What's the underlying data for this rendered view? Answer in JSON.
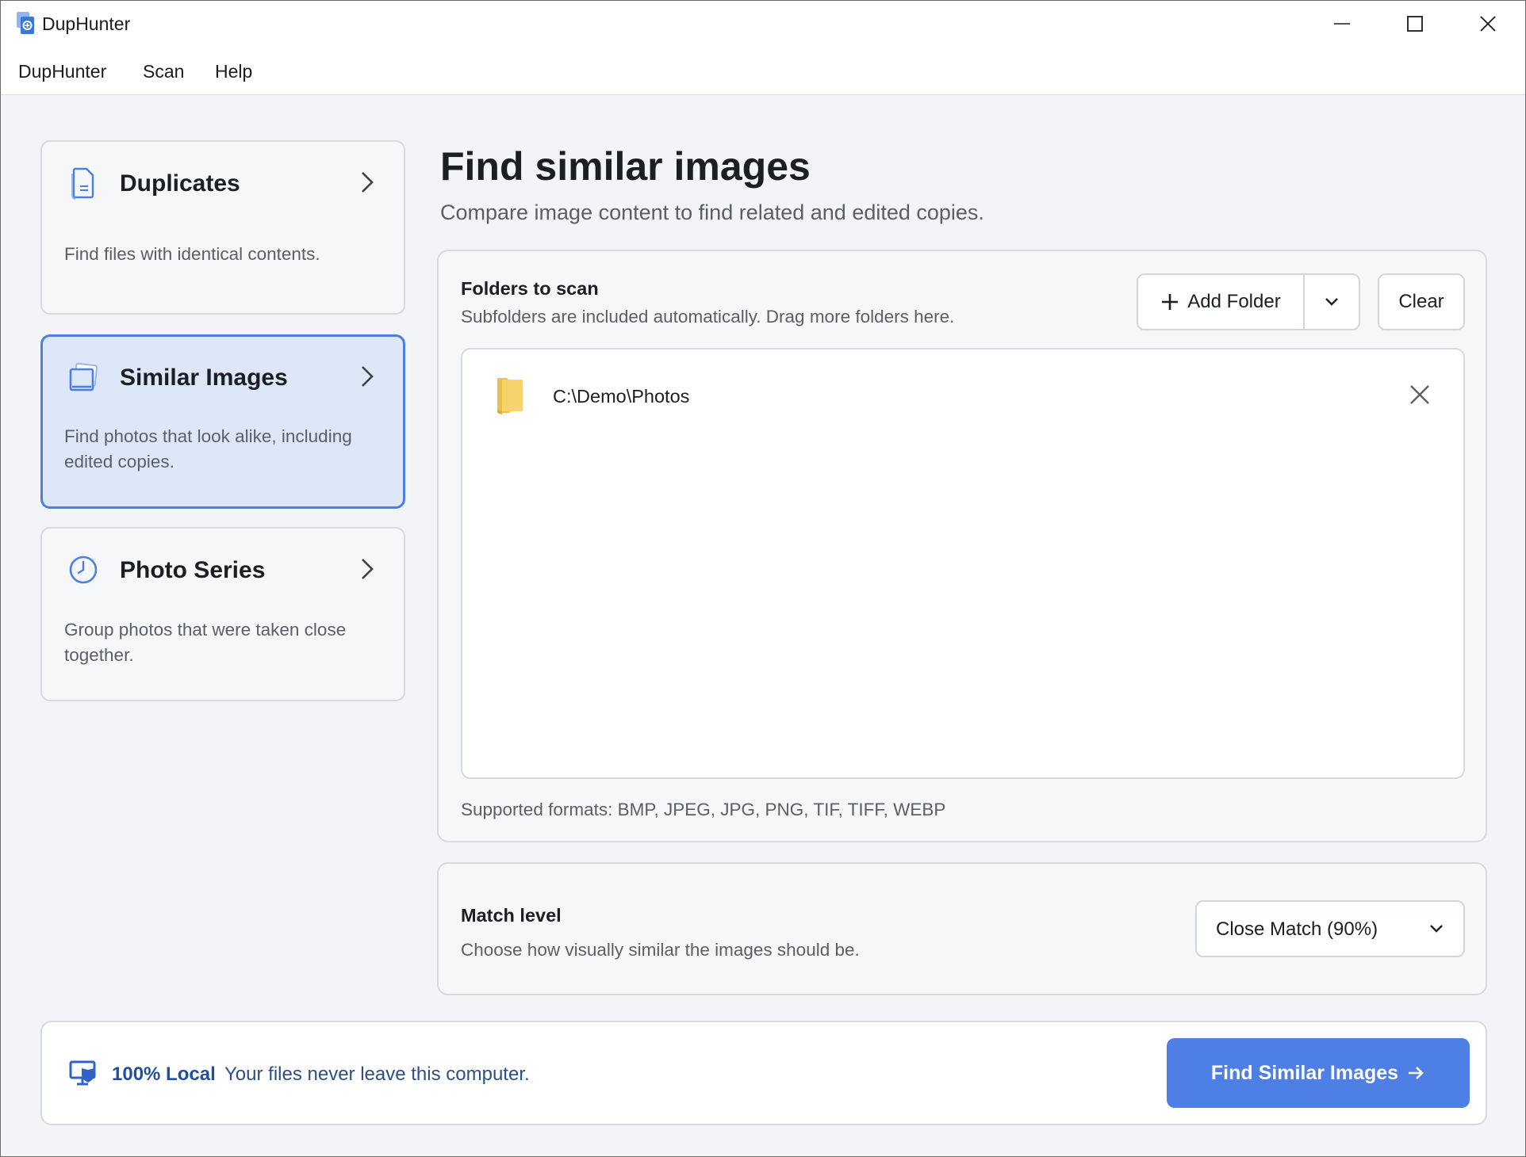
{
  "window": {
    "title": "DupHunter"
  },
  "menubar": {
    "items": [
      "DupHunter",
      "Scan",
      "Help"
    ]
  },
  "sidebar": {
    "modes": [
      {
        "title": "Duplicates",
        "description": "Find files with identical contents.",
        "icon": "document-icon",
        "active": false
      },
      {
        "title": "Similar Images",
        "description": "Find photos that look alike, including edited copies.",
        "icon": "photos-icon",
        "active": true
      },
      {
        "title": "Photo Series",
        "description": "Group photos that were taken close together.",
        "icon": "clock-icon",
        "active": false
      }
    ]
  },
  "main": {
    "title": "Find similar images",
    "subtitle": "Compare image content to find related and edited copies.",
    "folders": {
      "title": "Folders to scan",
      "description": "Subfolders are included automatically. Drag more folders here.",
      "add_label": "Add Folder",
      "clear_label": "Clear",
      "items": [
        {
          "path": "C:\\Demo\\Photos"
        }
      ],
      "formats": "Supported formats: BMP, JPEG, JPG, PNG, TIF, TIFF, WEBP"
    },
    "match": {
      "title": "Match level",
      "description": "Choose how visually similar the images should be.",
      "selected": "Close Match (90%)"
    }
  },
  "footer": {
    "badge": "100% Local",
    "description": "Your files never leave this computer.",
    "action_label": "Find Similar Images"
  },
  "colors": {
    "accent": "#4e7fe4",
    "active_card_bg": "#dde7f8",
    "active_card_border": "#4d7ee3",
    "footer_text": "#1f4f9e"
  }
}
